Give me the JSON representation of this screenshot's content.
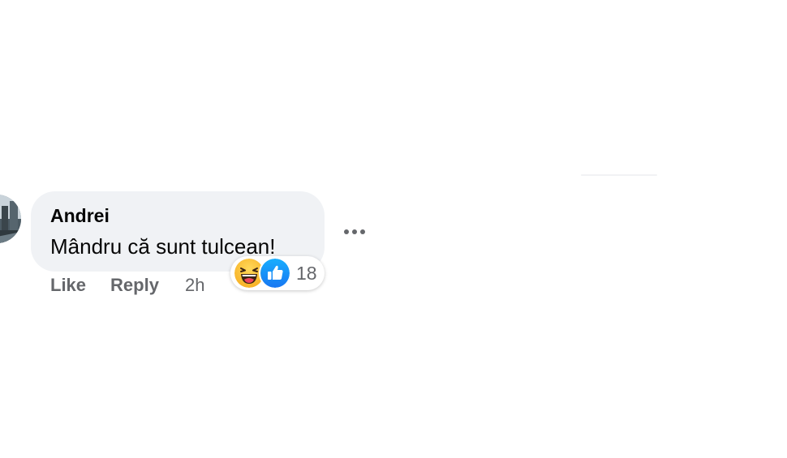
{
  "comment": {
    "author": "Andrei",
    "text": "Mândru că sunt tulcean!",
    "avatar": "avatar-photo",
    "bubble_color": "#f0f2f5"
  },
  "actions": {
    "like_label": "Like",
    "reply_label": "Reply",
    "timestamp": "2h"
  },
  "reactions": {
    "icons": [
      "haha-icon",
      "like-icon"
    ],
    "count": "18",
    "like_color": "#1877f2",
    "haha_color": "#f7b125"
  },
  "menu": {
    "icon": "more-options-icon"
  }
}
